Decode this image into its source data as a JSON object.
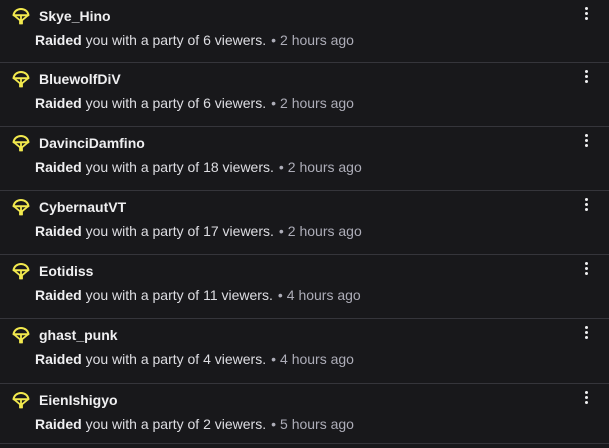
{
  "feed": {
    "items": [
      {
        "username": "Skye_Hino",
        "action": "Raided",
        "message": "you with a party of 6 viewers.",
        "separator": "•",
        "time": "2 hours ago",
        "icon": "raid-parachute-icon"
      },
      {
        "username": "BluewolfDiV",
        "action": "Raided",
        "message": "you with a party of 6 viewers.",
        "separator": "•",
        "time": "2 hours ago",
        "icon": "raid-parachute-icon"
      },
      {
        "username": "DavinciDamfino",
        "action": "Raided",
        "message": "you with a party of 18 viewers.",
        "separator": "•",
        "time": "2 hours ago",
        "icon": "raid-parachute-icon"
      },
      {
        "username": "CybernautVT",
        "action": "Raided",
        "message": "you with a party of 17 viewers.",
        "separator": "•",
        "time": "2 hours ago",
        "icon": "raid-parachute-icon"
      },
      {
        "username": "Eotidiss",
        "action": "Raided",
        "message": "you with a party of 11 viewers.",
        "separator": "•",
        "time": "4 hours ago",
        "icon": "raid-parachute-icon"
      },
      {
        "username": "ghast_punk",
        "action": "Raided",
        "message": "you with a party of 4 viewers.",
        "separator": "•",
        "time": "4 hours ago",
        "icon": "raid-parachute-icon"
      },
      {
        "username": "EienIshigyo",
        "action": "Raided",
        "message": "you with a party of 2 viewers.",
        "separator": "•",
        "time": "5 hours ago",
        "icon": "raid-parachute-icon"
      }
    ]
  },
  "colors": {
    "background": "#18181b",
    "divider": "#35353b",
    "raid_icon": "#f2e94e",
    "text_primary": "#efeff1",
    "text_muted": "#adadb8"
  }
}
